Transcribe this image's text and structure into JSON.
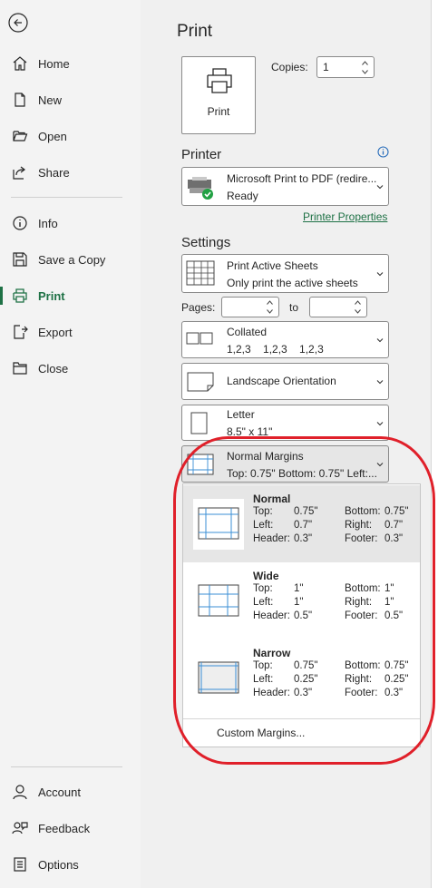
{
  "sidebar": {
    "items": [
      {
        "label": "Home",
        "icon": "home-icon"
      },
      {
        "label": "New",
        "icon": "new-document-icon"
      },
      {
        "label": "Open",
        "icon": "folder-open-icon"
      },
      {
        "label": "Share",
        "icon": "share-icon"
      },
      {
        "label": "Info",
        "icon": "info-icon"
      },
      {
        "label": "Save a Copy",
        "icon": "save-copy-icon"
      },
      {
        "label": "Print",
        "icon": "printer-icon"
      },
      {
        "label": "Export",
        "icon": "export-icon"
      },
      {
        "label": "Close",
        "icon": "close-folder-icon"
      }
    ],
    "bottom": [
      {
        "label": "Account",
        "icon": "person-icon"
      },
      {
        "label": "Feedback",
        "icon": "feedback-icon"
      },
      {
        "label": "Options",
        "icon": "options-icon"
      }
    ],
    "active_color": "#1e7145"
  },
  "print": {
    "title": "Print",
    "print_button": "Print",
    "copies_label": "Copies:",
    "copies_value": "1",
    "printer_header": "Printer",
    "printer_name": "Microsoft Print to PDF (redire...",
    "printer_status": "Ready",
    "printer_properties": "Printer Properties",
    "settings_header": "Settings",
    "active_sheets": {
      "title": "Print Active Sheets",
      "sub": "Only print the active sheets"
    },
    "pages_label": "Pages:",
    "to_label": "to",
    "collated": {
      "title": "Collated",
      "sub": "1,2,3    1,2,3    1,2,3"
    },
    "orientation": "Landscape Orientation",
    "paper": {
      "title": "Letter",
      "sub": "8.5\" x 11\""
    },
    "margins": {
      "title": "Normal Margins",
      "sub": "Top: 0.75\" Bottom: 0.75\" Left:..."
    }
  },
  "margin_menu": {
    "options": [
      {
        "name": "Normal",
        "top": "0.75\"",
        "bottom": "0.75\"",
        "left": "0.7\"",
        "right": "0.7\"",
        "header": "0.3\"",
        "footer": "0.3\""
      },
      {
        "name": "Wide",
        "top": "1\"",
        "bottom": "1\"",
        "left": "1\"",
        "right": "1\"",
        "header": "0.5\"",
        "footer": "0.5\""
      },
      {
        "name": "Narrow",
        "top": "0.75\"",
        "bottom": "0.75\"",
        "left": "0.25\"",
        "right": "0.25\"",
        "header": "0.3\"",
        "footer": "0.3\""
      }
    ],
    "labels": {
      "top": "Top:",
      "bottom": "Bottom:",
      "left": "Left:",
      "right": "Right:",
      "header": "Header:",
      "footer": "Footer:"
    },
    "custom": "Custom Margins..."
  },
  "colors": {
    "link": "#1e7145",
    "annotation": "#e0202a",
    "highlight": "#e6e6e6"
  }
}
